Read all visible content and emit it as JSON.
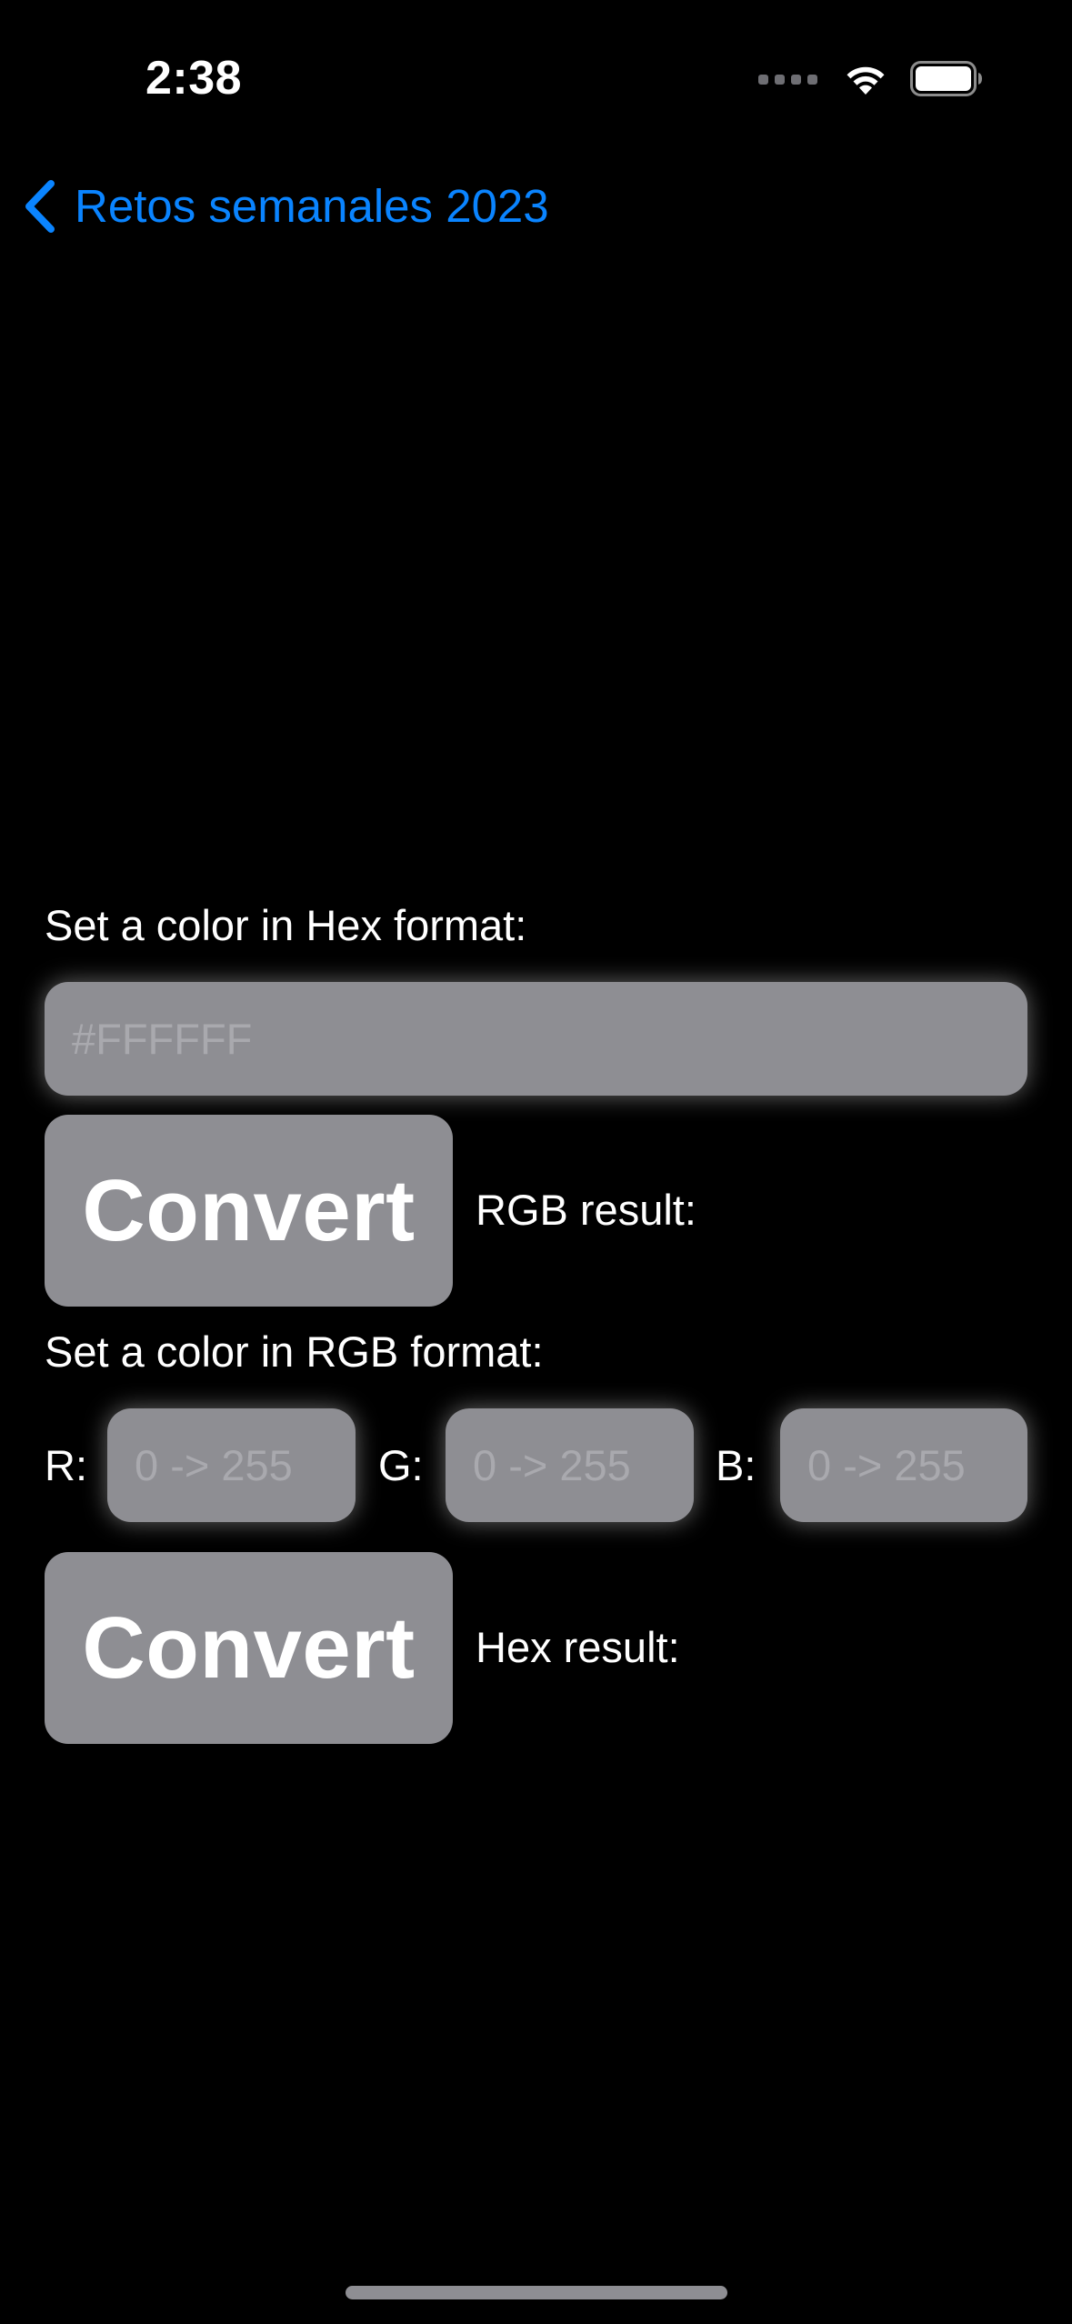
{
  "status_bar": {
    "time": "2:38",
    "icons": [
      "signal-dots-icon",
      "wifi-icon",
      "battery-icon"
    ]
  },
  "nav": {
    "back_label": "Retos semanales 2023",
    "back_icon": "chevron-left-icon",
    "accent_color": "#0a84ff"
  },
  "hex_section": {
    "label": "Set a color in Hex format:",
    "input_placeholder": "#FFFFFF",
    "input_value": "",
    "convert_label": "Convert",
    "result_label": "RGB result:"
  },
  "rgb_section": {
    "label": "Set a color in RGB format:",
    "r_label": "R:",
    "g_label": "G:",
    "b_label": "B:",
    "r_placeholder": "0 -> 255",
    "g_placeholder": "0 -> 255",
    "b_placeholder": "0 -> 255",
    "convert_label": "Convert",
    "result_label": "Hex result:"
  },
  "colors": {
    "background": "#000000",
    "control_fill": "#8e8e93",
    "placeholder_text": "#a9a9ae"
  }
}
